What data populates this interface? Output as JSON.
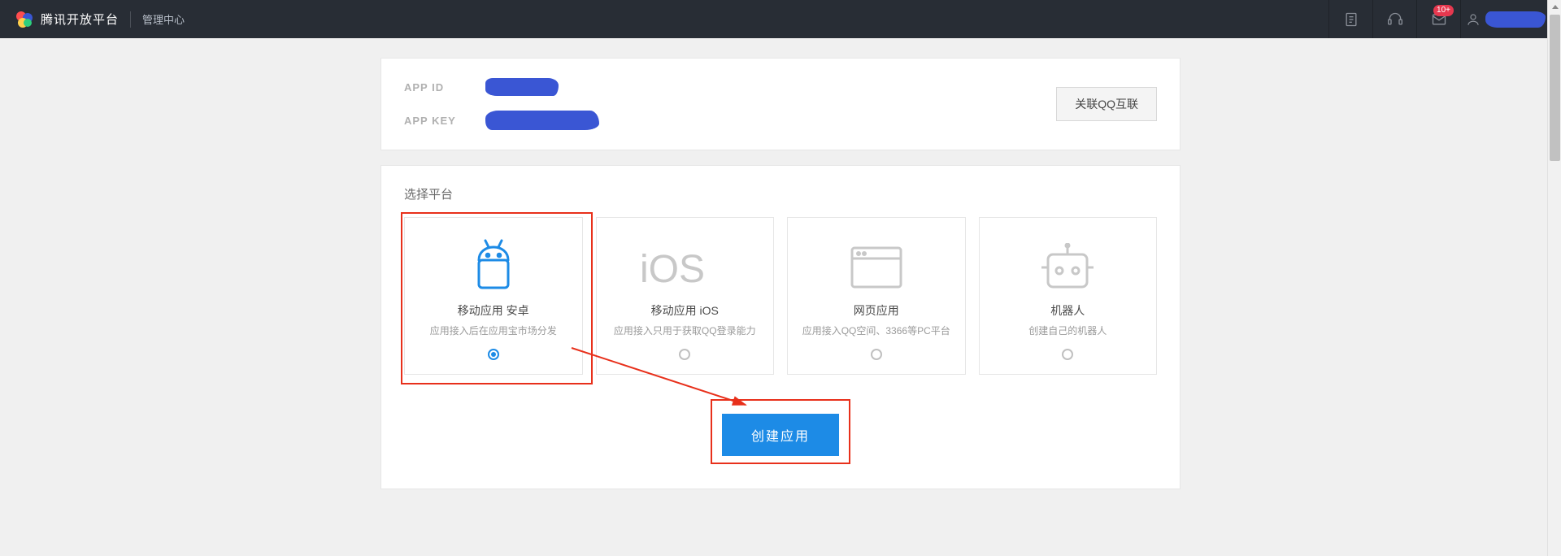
{
  "header": {
    "brand": "腾讯开放平台",
    "section": "管理中心",
    "notification_badge": "10+"
  },
  "info": {
    "app_id_label": "APP ID",
    "app_key_label": "APP KEY",
    "link_qq_button": "关联QQ互联"
  },
  "platform": {
    "section_title": "选择平台",
    "cards": [
      {
        "title": "移动应用 安卓",
        "desc": "应用接入后在应用宝市场分发",
        "selected": true
      },
      {
        "title": "移动应用 iOS",
        "desc": "应用接入只用于获取QQ登录能力",
        "selected": false
      },
      {
        "title": "网页应用",
        "desc": "应用接入QQ空间、3366等PC平台",
        "selected": false
      },
      {
        "title": "机器人",
        "desc": "创建自己的机器人",
        "selected": false
      }
    ],
    "create_button": "创建应用"
  }
}
